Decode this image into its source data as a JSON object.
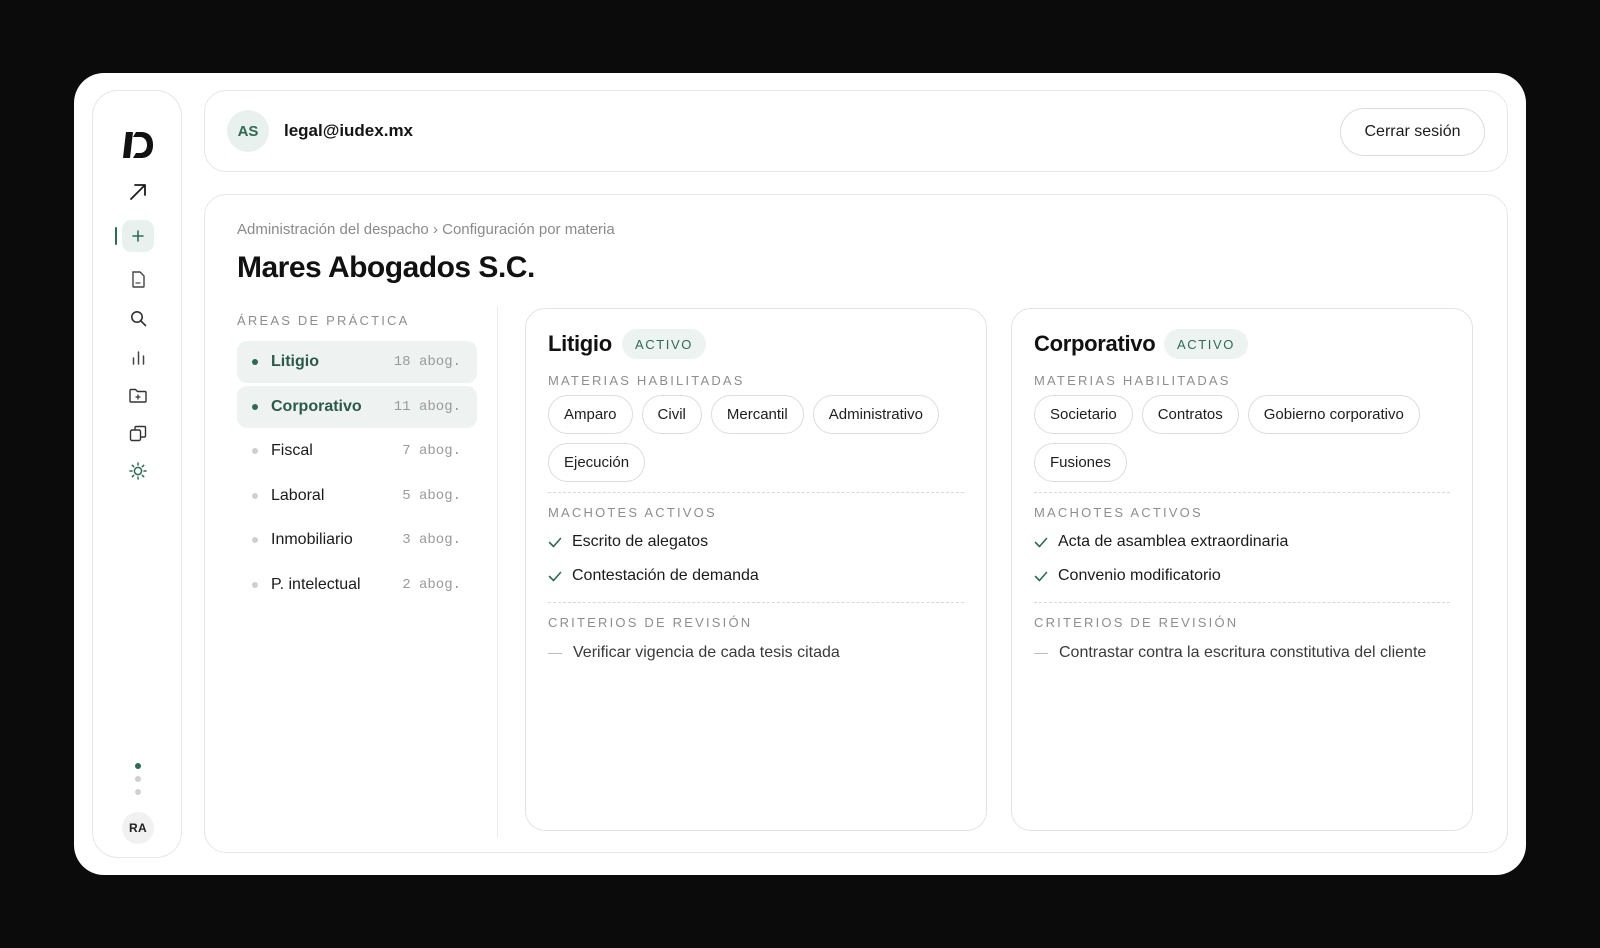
{
  "sidebar": {
    "items": [
      {
        "icon": "logo-icon"
      },
      {
        "icon": "arrow-up-right-icon"
      },
      {
        "icon": "plus-icon",
        "active": true
      },
      {
        "icon": "document-icon"
      },
      {
        "icon": "search-icon"
      },
      {
        "icon": "bar-chart-icon"
      },
      {
        "icon": "folder-plus-icon"
      },
      {
        "icon": "copy-icon"
      },
      {
        "icon": "settings-sun-icon"
      }
    ],
    "user_initials": "RA"
  },
  "header": {
    "avatar_initials": "AS",
    "email": "legal@iudex.mx",
    "logout_label": "Cerrar sesión"
  },
  "breadcrumb": {
    "parent": "Administración del despacho",
    "separator": "›",
    "current": "Configuración por materia"
  },
  "page_title": "Mares Abogados S.C.",
  "areas": {
    "label": "ÁREAS DE PRÁCTICA",
    "items": [
      {
        "name": "Litigio",
        "count": "18 abog.",
        "selected": true
      },
      {
        "name": "Corporativo",
        "count": "11 abog.",
        "selected": true
      },
      {
        "name": "Fiscal",
        "count": "7 abog.",
        "selected": false
      },
      {
        "name": "Laboral",
        "count": "5 abog.",
        "selected": false
      },
      {
        "name": "Inmobiliario",
        "count": "3 abog.",
        "selected": false
      },
      {
        "name": "P. intelectual",
        "count": "2 abog.",
        "selected": false
      }
    ]
  },
  "cards": [
    {
      "title": "Litigio",
      "status": "ACTIVO",
      "materias_label": "MATERIAS HABILITADAS",
      "materias": [
        "Amparo",
        "Civil",
        "Mercantil",
        "Administrativo",
        "Ejecución"
      ],
      "machotes_label": "MACHOTES ACTIVOS",
      "machotes": [
        "Escrito de alegatos",
        "Contestación de demanda"
      ],
      "criterios_label": "CRITERIOS DE REVISIÓN",
      "criterios": [
        "Verificar vigencia de cada tesis citada"
      ]
    },
    {
      "title": "Corporativo",
      "status": "ACTIVO",
      "materias_label": "MATERIAS HABILITADAS",
      "materias": [
        "Societario",
        "Contratos",
        "Gobierno corporativo",
        "Fusiones"
      ],
      "machotes_label": "MACHOTES ACTIVOS",
      "machotes": [
        "Acta de asamblea extraordinaria",
        "Convenio modificatorio"
      ],
      "criterios_label": "CRITERIOS DE REVISIÓN",
      "criterios": [
        "Contrastar contra la escritura constitutiva del cliente"
      ]
    }
  ],
  "colors": {
    "accent": "#2f6b54",
    "accent_soft": "#e9f1ee",
    "background": "#0b0b0b"
  }
}
